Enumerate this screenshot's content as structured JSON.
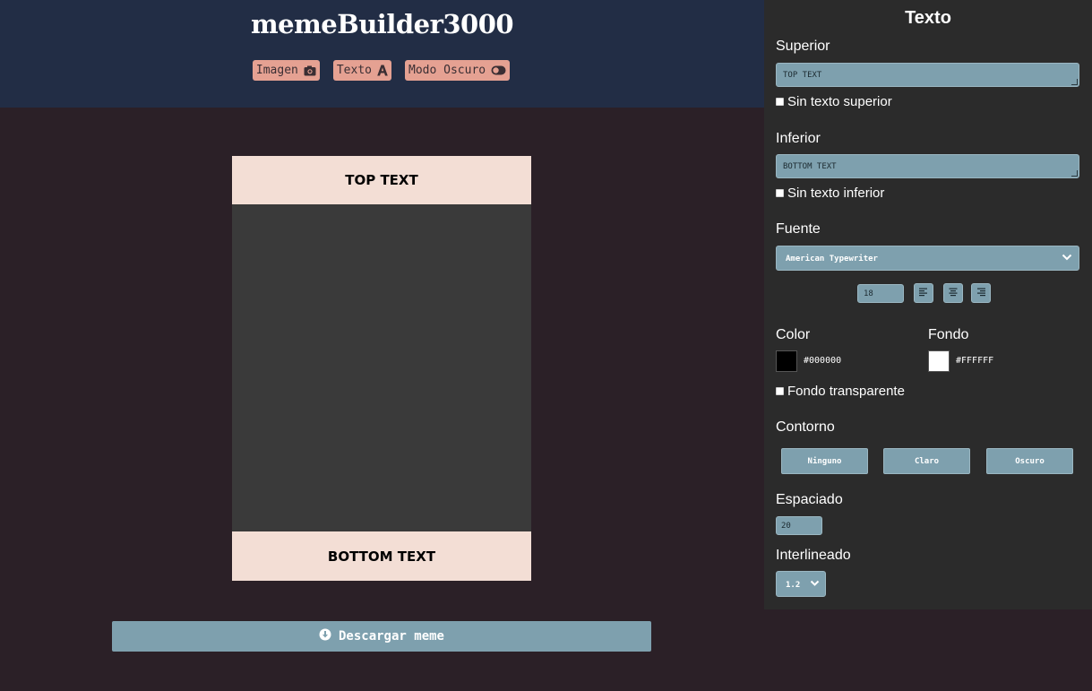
{
  "header": {
    "app_title": "memeBuilder3000",
    "nav": [
      {
        "label": "Imagen",
        "icon": "camera-icon"
      },
      {
        "label": "Texto",
        "icon": "letter-a-icon"
      },
      {
        "label": "Modo Oscuro",
        "icon": "toggle-icon"
      }
    ]
  },
  "meme": {
    "top_text": "TOP TEXT",
    "bottom_text": "BOTTOM TEXT"
  },
  "download": {
    "label": "Descargar meme",
    "icon": "download-circle-icon"
  },
  "panel": {
    "title": "Texto",
    "top": {
      "label": "Superior",
      "value": "TOP TEXT",
      "checkbox_label": "Sin texto superior",
      "checked": false
    },
    "bottom": {
      "label": "Inferior",
      "value": "BOTTOM TEXT",
      "checkbox_label": "Sin texto inferior",
      "checked": false
    },
    "font": {
      "label": "Fuente",
      "selected": "American Typewriter",
      "size": "18",
      "align_icons": [
        "align-left-icon",
        "align-center-icon",
        "align-right-icon"
      ]
    },
    "color": {
      "label": "Color",
      "value": "#000000"
    },
    "background": {
      "label": "Fondo",
      "value": "#FFFFFF"
    },
    "transparent": {
      "label": "Fondo transparente",
      "checked": false
    },
    "outline": {
      "label": "Contorno",
      "options": [
        "Ninguno",
        "Claro",
        "Oscuro"
      ]
    },
    "spacing": {
      "label": "Espaciado",
      "value": "20"
    },
    "line_height": {
      "label": "Interlineado",
      "value": "1.2"
    }
  },
  "colors": {
    "header_bg": "#222d45",
    "page_bg": "#2b2027",
    "panel_bg": "#2b2b2b",
    "nav_button": "#e5a192",
    "control_bg": "#7ea0ae",
    "meme_text_bg": "#f3ded5",
    "meme_image_bg": "#3a3a3a"
  }
}
